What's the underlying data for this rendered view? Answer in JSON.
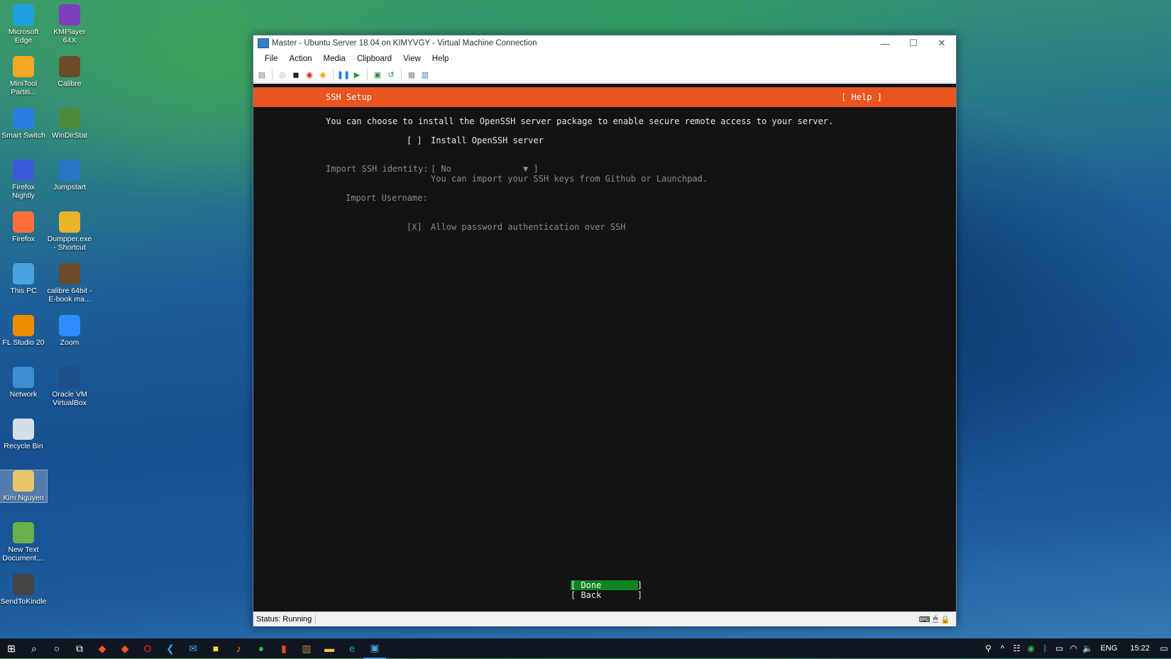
{
  "desktop": {
    "icons": [
      {
        "label": "Microsoft Edge",
        "color": "#1fa0e0"
      },
      {
        "label": "KMPlayer 64X",
        "color": "#7b3fbf"
      },
      {
        "label": "MiniTool Partiti...",
        "color": "#f5a623"
      },
      {
        "label": "Calibre",
        "color": "#6b4b2a"
      },
      {
        "label": "Smart Switch",
        "color": "#2b7de1"
      },
      {
        "label": "WinDirStat",
        "color": "#4a8a3a"
      },
      {
        "label": "Firefox Nightly",
        "color": "#3b5bdb"
      },
      {
        "label": "Jumpstart",
        "color": "#2a76c6"
      },
      {
        "label": "Firefox",
        "color": "#ff7139"
      },
      {
        "label": "Dumpper.exe - Shortcut",
        "color": "#e8b42a"
      },
      {
        "label": "This PC",
        "color": "#4aa3df"
      },
      {
        "label": "calibre 64bit - E-book ma...",
        "color": "#6b4b2a"
      },
      {
        "label": "FL Studio 20",
        "color": "#f08c00"
      },
      {
        "label": "Zoom",
        "color": "#2d8cff"
      },
      {
        "label": "Network",
        "color": "#3d8fd1"
      },
      {
        "label": "Oracle VM VirtualBox",
        "color": "#1d4e89"
      },
      {
        "label": "Recycle Bin",
        "color": "#d5dde6"
      },
      {
        "label": "Kim Nguyen",
        "color": "#e8c56a"
      },
      {
        "label": "New Text Document....",
        "color": "#6ab04c"
      },
      {
        "label": "SendToKindle",
        "color": "#444444"
      }
    ]
  },
  "window": {
    "title": "Master - Ubuntu Server 18.04 on KIMYVGY - Virtual Machine Connection",
    "controls": {
      "minimize": "—",
      "maximize": "☐",
      "close": "✕"
    },
    "menu": [
      "File",
      "Action",
      "Media",
      "Clipboard",
      "View",
      "Help"
    ],
    "status": "Status: Running"
  },
  "installer": {
    "header_title": "SSH Setup",
    "help": "[ Help ]",
    "intro": "You can choose to install the OpenSSH server package to enable secure remote access to your server.",
    "install_checkbox": "[ ]",
    "install_label": "Install OpenSSH server",
    "import_identity_label": "Import SSH identity:",
    "import_identity_value": "[ No              ▼ ]",
    "import_identity_help": "You can import your SSH keys from Github or Launchpad.",
    "import_username_label": "Import Username:",
    "password_checkbox": "[X]",
    "password_label": "Allow password authentication over SSH",
    "done": "[ Done       ]",
    "back": "[ Back       ]"
  },
  "taskbar": {
    "lang": "ENG",
    "time": "15:22"
  },
  "colors": {
    "ubuntu_orange": "#e95420",
    "done_green": "#0e8420",
    "console_bg": "#131313"
  }
}
